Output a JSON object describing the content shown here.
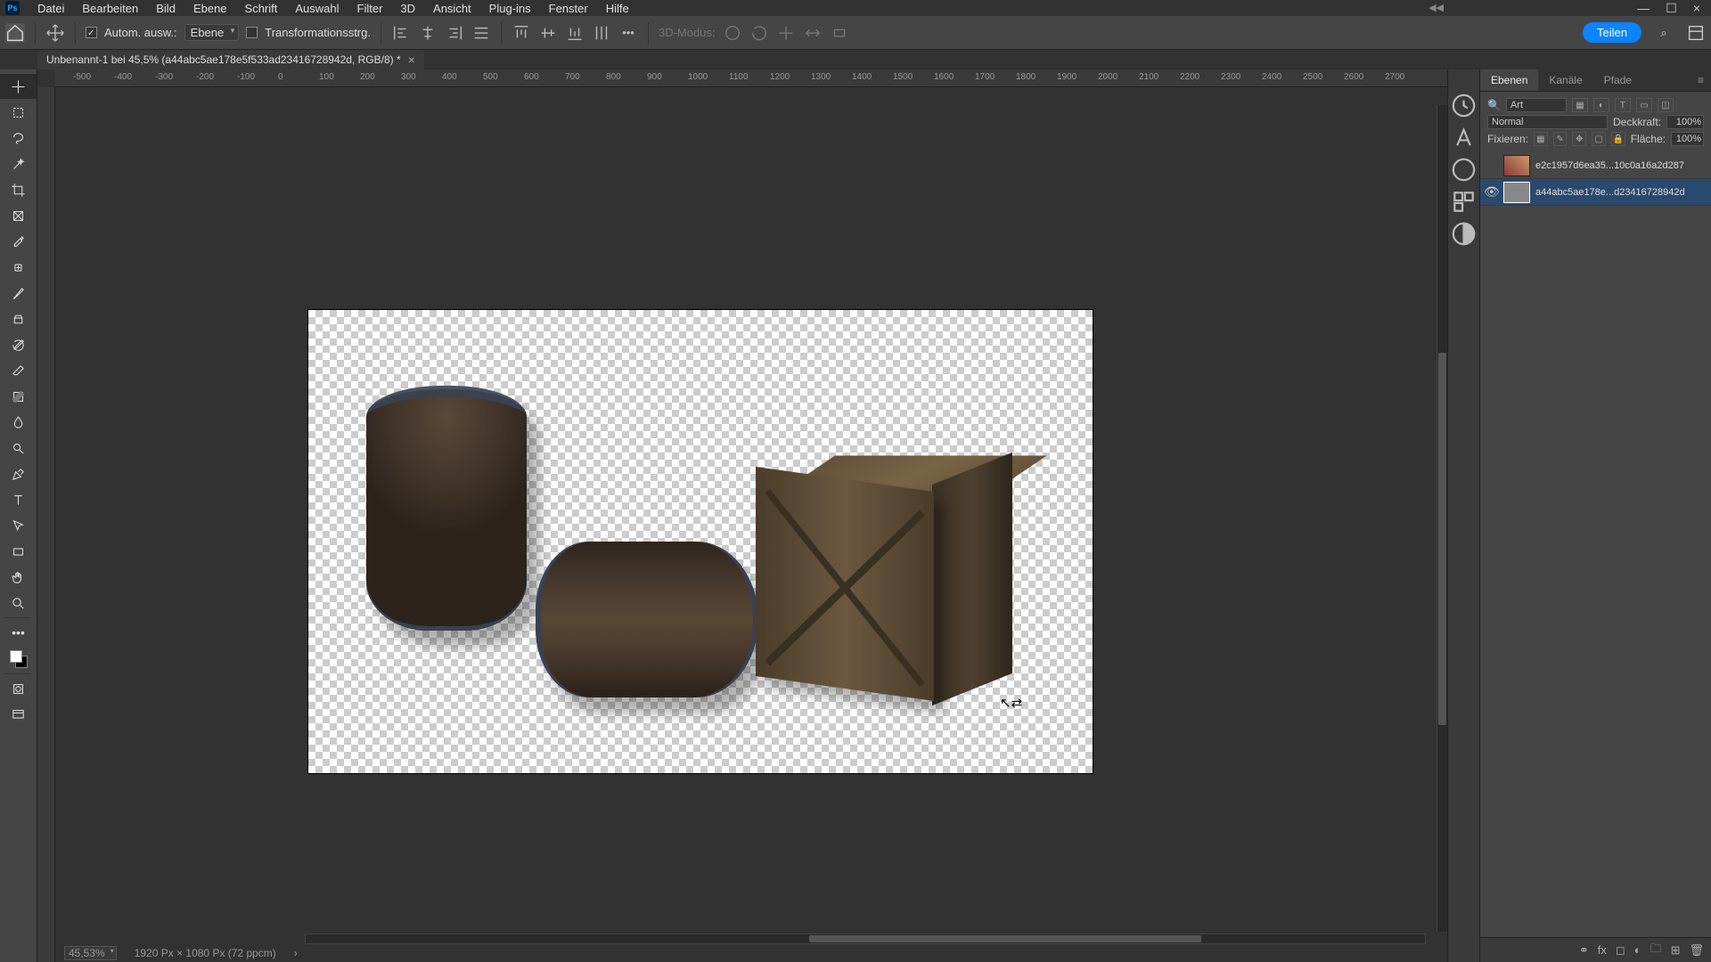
{
  "menubar": {
    "logo": "Ps",
    "items": [
      "Datei",
      "Bearbeiten",
      "Bild",
      "Ebene",
      "Schrift",
      "Auswahl",
      "Filter",
      "3D",
      "Ansicht",
      "Plug-ins",
      "Fenster",
      "Hilfe"
    ]
  },
  "optbar": {
    "auto_select": "Autom. ausw.:",
    "layer_drop": "Ebene",
    "transform": "Transformationsstrg.",
    "mode_3d": "3D-Modus:",
    "share": "Teilen"
  },
  "doc_tab": {
    "title": "Unbenannt-1 bei 45,5% (a44abc5ae178e5f533ad23416728942d, RGB/8) *"
  },
  "ruler_marks": [
    "-500",
    "-400",
    "-300",
    "-200",
    "-100",
    "0",
    "100",
    "200",
    "300",
    "400",
    "500",
    "600",
    "700",
    "800",
    "900",
    "1000",
    "1100",
    "1200",
    "1300",
    "1400",
    "1500",
    "1600",
    "1700",
    "1800",
    "1900",
    "2000",
    "2100",
    "2200",
    "2300",
    "2400",
    "2500",
    "2600",
    "2700"
  ],
  "status": {
    "zoom": "45,53%",
    "dims": "1920 Px × 1080 Px (72 ppcm)"
  },
  "panels": {
    "tabs": [
      "Ebenen",
      "Kanäle",
      "Pfade"
    ],
    "search_label": "Art",
    "blend": "Normal",
    "opacity_label": "Deckkraft:",
    "opacity_value": "100%",
    "lock_label": "Fixieren:",
    "fill_label": "Fläche:",
    "fill_value": "100%",
    "layers": [
      {
        "eye": false,
        "name": "e2c1957d6ea35...10c0a16a2d287"
      },
      {
        "eye": true,
        "name": "a44abc5ae178e...d23416728942d"
      }
    ]
  },
  "icons": {
    "search": "⌕",
    "close": "×",
    "minimize": "—",
    "maximize": "☐"
  }
}
